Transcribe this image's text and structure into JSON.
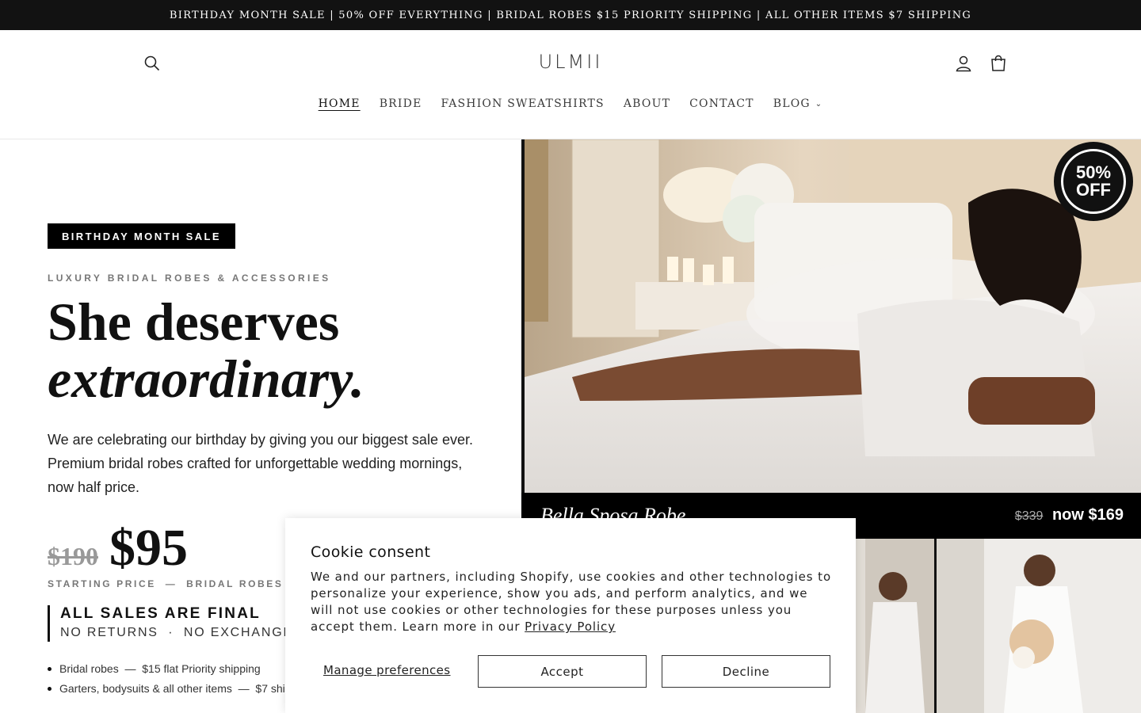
{
  "announcement": "BIRTHDAY MONTH SALE | 50% OFF EVERYTHING | BRIDAL ROBES $15 PRIORITY SHIPPING | ALL OTHER ITEMS $7 SHIPPING",
  "header": {
    "logo": "ULMII",
    "icons": [
      "search-icon",
      "account-icon",
      "cart-icon"
    ]
  },
  "nav": [
    {
      "label": "HOME",
      "active": true
    },
    {
      "label": "BRIDE"
    },
    {
      "label": "FASHION SWEATSHIRTS"
    },
    {
      "label": "ABOUT"
    },
    {
      "label": "CONTACT"
    },
    {
      "label": "BLOG"
    }
  ],
  "hero": {
    "badge": "BIRTHDAY MONTH SALE",
    "eyebrow": "LUXURY BRIDAL ROBES & ACCESSORIES",
    "headline_1": "She deserves",
    "headline_2": "extraordinary.",
    "description": "We are celebrating our birthday by giving you our biggest sale ever. Premium bridal robes crafted for unforgettable wedding mornings, now half price.",
    "old_price": "$190",
    "new_price": "$95",
    "price_caption": "STARTING PRICE  —  BRIDAL ROBES",
    "final_title": "ALL SALES ARE FINAL",
    "final_sub": "NO RETURNS  ·  NO EXCHANGES",
    "bullets": [
      "Bridal robes  —  $15 flat Priority shipping",
      "Garters, bodysuits & all other items  —  $7 shipping"
    ]
  },
  "feature": {
    "discount_line1": "50%",
    "discount_line2": "OFF",
    "product_name": "Bella Sposa Robe",
    "old_price": "$339",
    "new_price": "now $169"
  },
  "cookie": {
    "title": "Cookie consent",
    "body": "We and our partners, including Shopify, use cookies and other technologies to personalize your experience, show you ads, and perform analytics, and we will not use cookies or other technologies for these purposes unless you accept them. Learn more in our",
    "link": "Privacy Policy",
    "manage": "Manage preferences",
    "accept": "Accept",
    "decline": "Decline"
  }
}
